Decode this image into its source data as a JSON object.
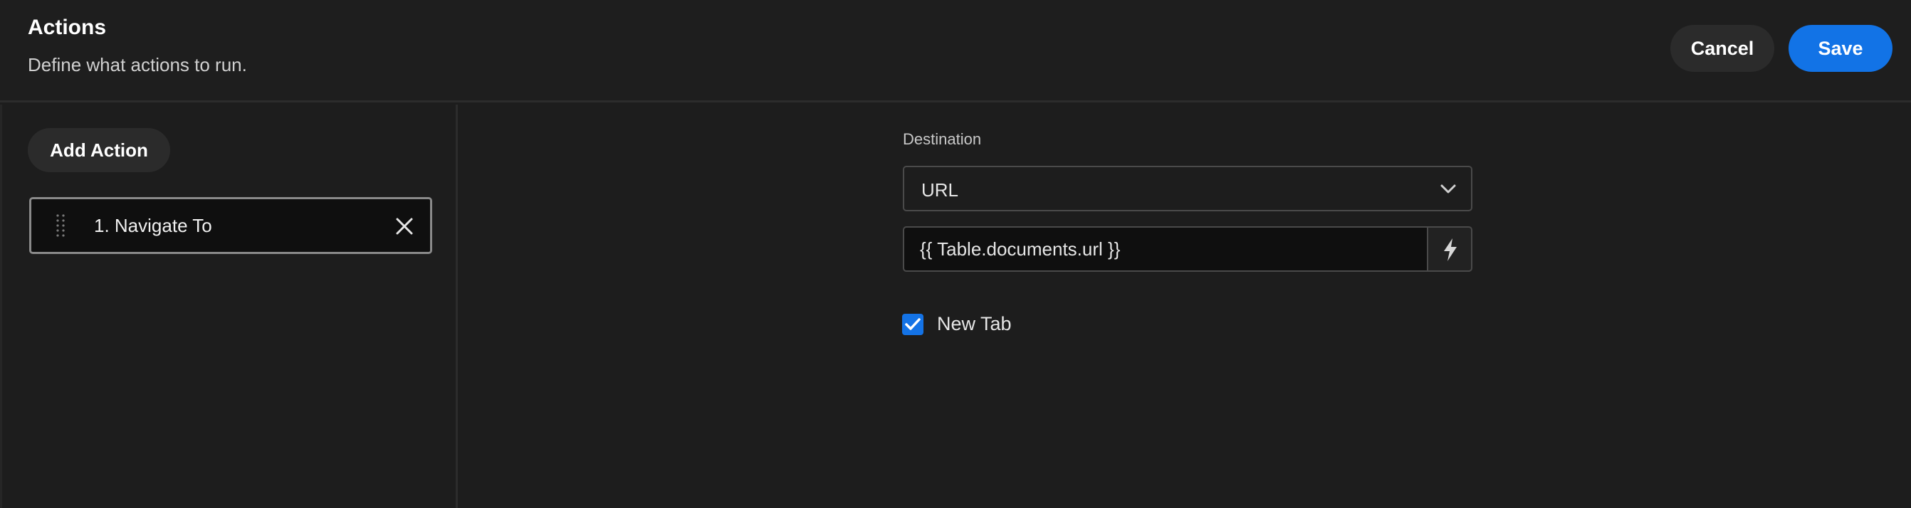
{
  "header": {
    "title": "Actions",
    "subtitle": "Define what actions to run.",
    "cancel_label": "Cancel",
    "save_label": "Save"
  },
  "sidebar": {
    "add_action_label": "Add Action",
    "actions": [
      {
        "label": "1. Navigate To"
      }
    ]
  },
  "form": {
    "destination_label": "Destination",
    "destination_type": "URL",
    "url_value": "{{ Table.documents.url }}",
    "new_tab_label": "New Tab",
    "new_tab_checked": true
  },
  "icons": {
    "drag": "drag-handle-icon",
    "remove": "close-icon",
    "dropdown": "chevron-down-icon",
    "binding": "lightning-bolt-icon",
    "check": "checkmark-icon"
  },
  "colors": {
    "accent": "#1273e6",
    "background": "#1d1d1d"
  }
}
